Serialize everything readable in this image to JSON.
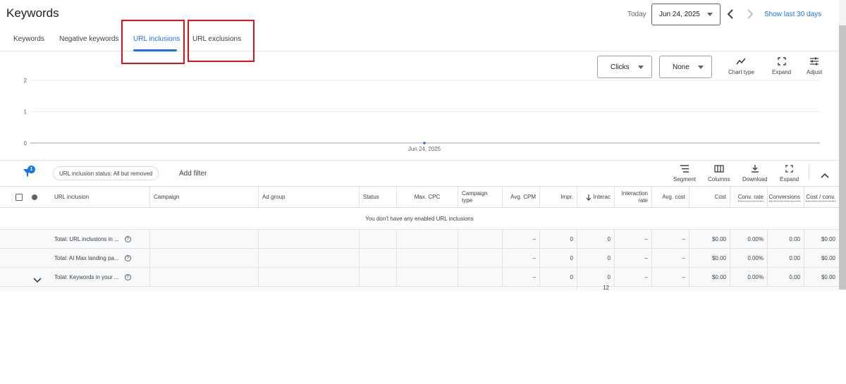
{
  "header": {
    "title": "Keywords",
    "today_label": "Today",
    "date_value": "Jun 24, 2025",
    "show_last_label": "Show last 30 days"
  },
  "tabs": [
    {
      "label": "Keywords",
      "active": false
    },
    {
      "label": "Negative keywords",
      "active": false
    },
    {
      "label": "URL inclusions",
      "active": true
    },
    {
      "label": "URL exclusions",
      "active": false
    }
  ],
  "chart_controls": {
    "metric1": "Clicks",
    "metric1_color": "#1a73e8",
    "metric2": "None",
    "metric2_color": "#d93025",
    "chart_type_label": "Chart type",
    "expand_label": "Expand",
    "adjust_label": "Adjust"
  },
  "chart_data": {
    "type": "line",
    "x": [
      "Jun 24, 2025"
    ],
    "series": [
      {
        "values": [
          0
        ]
      }
    ],
    "y_ticks": [
      "2",
      "1",
      "0"
    ],
    "ylim": [
      0,
      2
    ],
    "grid": true
  },
  "filter_bar": {
    "badge_count": "1",
    "chip_label": "URL inclusion status: All but removed",
    "add_filter_label": "Add filter",
    "segment_label": "Segment",
    "columns_label": "Columns",
    "download_label": "Download",
    "expand_label": "Expand"
  },
  "table": {
    "columns": {
      "url_inclusion": "URL inclusion",
      "campaign": "Campaign",
      "ad_group": "Ad group",
      "status": "Status",
      "max_cpc": "Max. CPC",
      "campaign_type_1": "Campaign",
      "campaign_type_2": "type",
      "avg_cpm": "Avg. CPM",
      "impr": "Impr.",
      "interactions": "Interac",
      "interaction_rate_1": "Interaction",
      "interaction_rate_2": "rate",
      "avg_cost": "Avg. cost",
      "cost": "Cost",
      "conv_rate": "Conv. rate",
      "conversions": "Conversions",
      "cost_per_conv": "Cost / conv."
    },
    "empty_message": "You don't have any enabled URL inclusions",
    "total_rows": [
      {
        "label": "Total: URL inclusions in ...",
        "avg_cpm": "–",
        "impr": "0",
        "interactions": "0",
        "interaction_rate": "–",
        "avg_cost": "–",
        "cost": "$0.00",
        "conv_rate": "0.00%",
        "conversions": "0.00",
        "cost_per_conv": "$0.00"
      },
      {
        "label": "Total: AI Max landing pa...",
        "avg_cpm": "–",
        "impr": "0",
        "interactions": "0",
        "interaction_rate": "–",
        "avg_cost": "–",
        "cost": "$0.00",
        "conv_rate": "0.00%",
        "conversions": "0.00",
        "cost_per_conv": "$0.00"
      },
      {
        "label": "Total: Keywords in your ...",
        "avg_cpm": "–",
        "impr": "0",
        "interactions": "0",
        "interaction_rate": "–",
        "avg_cost": "–",
        "cost": "$0.00",
        "conv_rate": "0.00%",
        "conversions": "0.00",
        "cost_per_conv": "$0.00"
      }
    ],
    "partial_value": "12"
  }
}
